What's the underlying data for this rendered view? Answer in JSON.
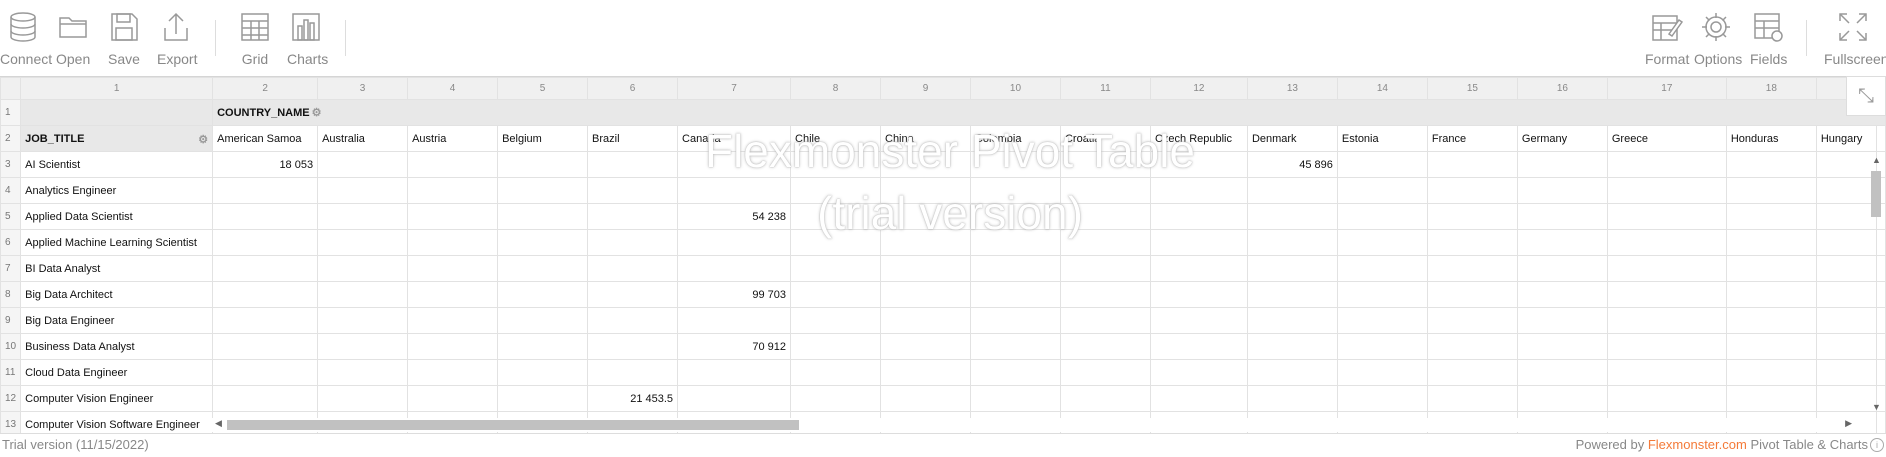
{
  "toolbar": {
    "left": [
      {
        "label": "Connect",
        "icon": "database-icon"
      },
      {
        "label": "Open",
        "icon": "folder-icon"
      },
      {
        "label": "Save",
        "icon": "floppy-disk-icon"
      },
      {
        "label": "Export",
        "icon": "export-icon"
      },
      {
        "label": "Grid",
        "icon": "grid-icon"
      },
      {
        "label": "Charts",
        "icon": "bar-chart-icon"
      }
    ],
    "right": [
      {
        "label": "Format",
        "icon": "format-icon"
      },
      {
        "label": "Options",
        "icon": "gear-icon"
      },
      {
        "label": "Fields",
        "icon": "fields-icon"
      },
      {
        "label": "Fullscreen",
        "icon": "fullscreen-icon"
      }
    ]
  },
  "grid": {
    "column_numbers": [
      "1",
      "2",
      "3",
      "4",
      "5",
      "6",
      "7",
      "8",
      "9",
      "10",
      "11",
      "12",
      "13",
      "14",
      "15",
      "16",
      "17",
      "18",
      ""
    ],
    "column_field": "COUNTRY_NAME",
    "row_field": "JOB_TITLE",
    "countries": [
      "American Samoa",
      "Australia",
      "Austria",
      "Belgium",
      "Brazil",
      "Canada",
      "Chile",
      "China",
      "Colombia",
      "Croatia",
      "Czech Republic",
      "Denmark",
      "Estonia",
      "France",
      "Germany",
      "Greece",
      "Honduras",
      "Hungary"
    ],
    "rows": [
      {
        "num": "3",
        "title": "AI Scientist",
        "values": [
          "18 053",
          "",
          "",
          "",
          "",
          "",
          "",
          "",
          "",
          "",
          "",
          "45 896",
          "",
          "",
          "",
          "",
          "",
          ""
        ]
      },
      {
        "num": "4",
        "title": "Analytics Engineer",
        "values": [
          "",
          "",
          "",
          "",
          "",
          "",
          "",
          "",
          "",
          "",
          "",
          "",
          "",
          "",
          "",
          "",
          "",
          ""
        ]
      },
      {
        "num": "5",
        "title": "Applied Data Scientist",
        "values": [
          "",
          "",
          "",
          "",
          "",
          "54 238",
          "",
          "",
          "",
          "",
          "",
          "",
          "",
          "",
          "",
          "",
          "",
          ""
        ]
      },
      {
        "num": "6",
        "title": "Applied Machine Learning Scientist",
        "values": [
          "",
          "",
          "",
          "",
          "",
          "",
          "",
          "",
          "",
          "",
          "",
          "",
          "",
          "",
          "",
          "",
          "",
          ""
        ]
      },
      {
        "num": "7",
        "title": "BI Data Analyst",
        "values": [
          "",
          "",
          "",
          "",
          "",
          "",
          "",
          "",
          "",
          "",
          "",
          "",
          "",
          "",
          "",
          "",
          "",
          ""
        ]
      },
      {
        "num": "8",
        "title": "Big Data Architect",
        "values": [
          "",
          "",
          "",
          "",
          "",
          "99 703",
          "",
          "",
          "",
          "",
          "",
          "",
          "",
          "",
          "",
          "",
          "",
          ""
        ]
      },
      {
        "num": "9",
        "title": "Big Data Engineer",
        "values": [
          "",
          "",
          "",
          "",
          "",
          "",
          "",
          "",
          "",
          "",
          "",
          "",
          "",
          "",
          "",
          "",
          "",
          ""
        ]
      },
      {
        "num": "10",
        "title": "Business Data Analyst",
        "values": [
          "",
          "",
          "",
          "",
          "",
          "70 912",
          "",
          "",
          "",
          "",
          "",
          "",
          "",
          "",
          "",
          "",
          "",
          ""
        ]
      },
      {
        "num": "11",
        "title": "Cloud Data Engineer",
        "values": [
          "",
          "",
          "",
          "",
          "",
          "",
          "",
          "",
          "",
          "",
          "",
          "",
          "",
          "",
          "",
          "",
          "",
          ""
        ]
      },
      {
        "num": "12",
        "title": "Computer Vision Engineer",
        "values": [
          "",
          "",
          "",
          "",
          "21 453.5",
          "",
          "",
          "",
          "",
          "",
          "",
          "",
          "",
          "",
          "",
          "",
          "",
          ""
        ]
      },
      {
        "num": "13",
        "title": "Computer Vision Software Engineer",
        "values": [
          "",
          "",
          "",
          "",
          "",
          "",
          "",
          "",
          "",
          "",
          "",
          "",
          "",
          "",
          "",
          "",
          "",
          ""
        ]
      }
    ]
  },
  "watermark": {
    "line1": "Flexmonster Pivot Table",
    "line2": "(trial version)"
  },
  "status": {
    "left": "Trial version (11/15/2022)",
    "powered_by": "Powered by",
    "brand": "Flexmonster.com",
    "suffix": "Pivot Table & Charts"
  },
  "colors": {
    "accent": "#f47a38",
    "header_bg": "#f0f0f0",
    "gray_cell": "#e8e8e8"
  }
}
